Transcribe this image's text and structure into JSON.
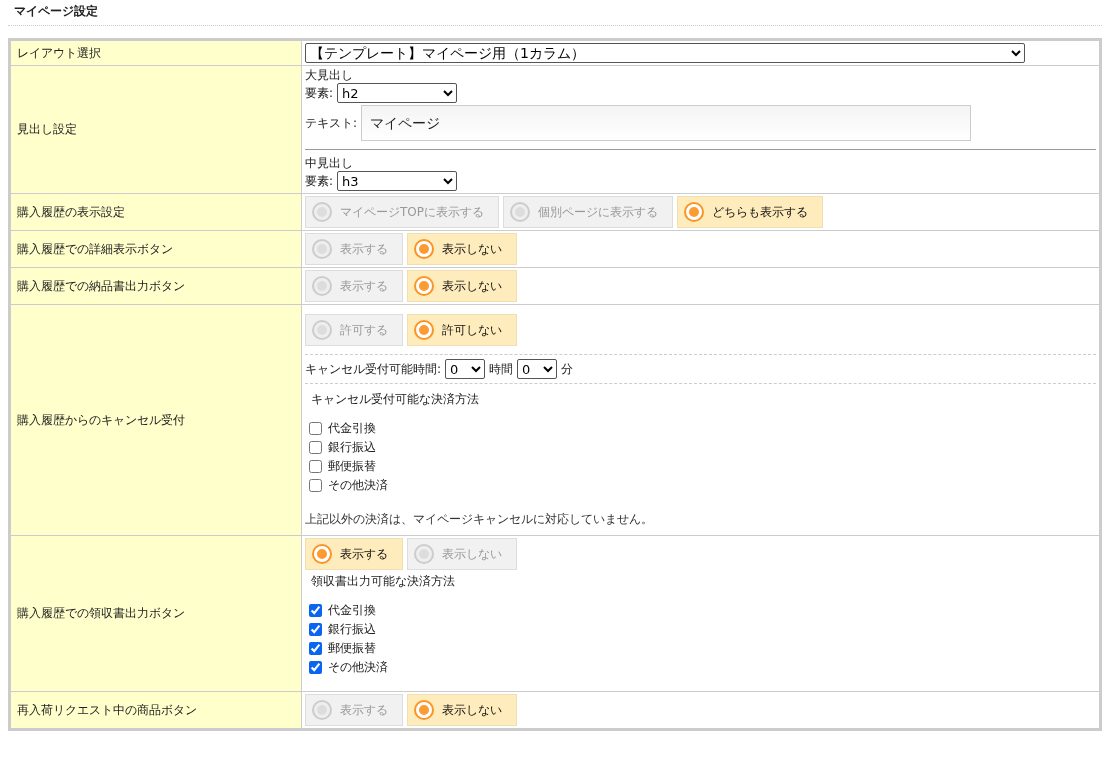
{
  "page_title": "マイページ設定",
  "rows": [
    {
      "label": "レイアウト選択",
      "kind": "select",
      "value": "【テンプレート】マイページ用（1カラム）"
    },
    {
      "label": "見出し設定",
      "kind": "headings",
      "large": {
        "title": "大見出し",
        "element_label": "要素:",
        "element": "h2",
        "text_label": "テキスト:",
        "text": "マイページ"
      },
      "medium": {
        "title": "中見出し",
        "element_label": "要素:",
        "element": "h3"
      }
    },
    {
      "label": "購入履歴の表示設定",
      "kind": "radio",
      "options": [
        {
          "label": "マイページTOPに表示する",
          "selected": false
        },
        {
          "label": "個別ページに表示する",
          "selected": false
        },
        {
          "label": "どちらも表示する",
          "selected": true
        }
      ]
    },
    {
      "label": "購入履歴での詳細表示ボタン",
      "kind": "radio",
      "options": [
        {
          "label": "表示する",
          "selected": false
        },
        {
          "label": "表示しない",
          "selected": true
        }
      ]
    },
    {
      "label": "購入履歴での納品書出力ボタン",
      "kind": "radio",
      "options": [
        {
          "label": "表示する",
          "selected": false
        },
        {
          "label": "表示しない",
          "selected": true
        }
      ]
    },
    {
      "label": "購入履歴からのキャンセル受付",
      "kind": "cancel",
      "options": [
        {
          "label": "許可する",
          "selected": false
        },
        {
          "label": "許可しない",
          "selected": true
        }
      ],
      "time": {
        "label": "キャンセル受付可能時間:",
        "hours": "0",
        "hours_unit": "時間",
        "minutes": "0",
        "minutes_unit": "分"
      },
      "methods_title": "キャンセル受付可能な決済方法",
      "methods": [
        {
          "label": "代金引換",
          "checked": false
        },
        {
          "label": "銀行振込",
          "checked": false
        },
        {
          "label": "郵便振替",
          "checked": false
        },
        {
          "label": "その他決済",
          "checked": false
        }
      ],
      "note": "上記以外の決済は、マイページキャンセルに対応していません。"
    },
    {
      "label": "購入履歴での領収書出力ボタン",
      "kind": "receipt",
      "options": [
        {
          "label": "表示する",
          "selected": true
        },
        {
          "label": "表示しない",
          "selected": false
        }
      ],
      "methods_title": "領収書出力可能な決済方法",
      "methods": [
        {
          "label": "代金引換",
          "checked": true
        },
        {
          "label": "銀行振込",
          "checked": true
        },
        {
          "label": "郵便振替",
          "checked": true
        },
        {
          "label": "その他決済",
          "checked": true
        }
      ]
    },
    {
      "label": "再入荷リクエスト中の商品ボタン",
      "kind": "radio",
      "options": [
        {
          "label": "表示する",
          "selected": false
        },
        {
          "label": "表示しない",
          "selected": true
        }
      ]
    }
  ]
}
